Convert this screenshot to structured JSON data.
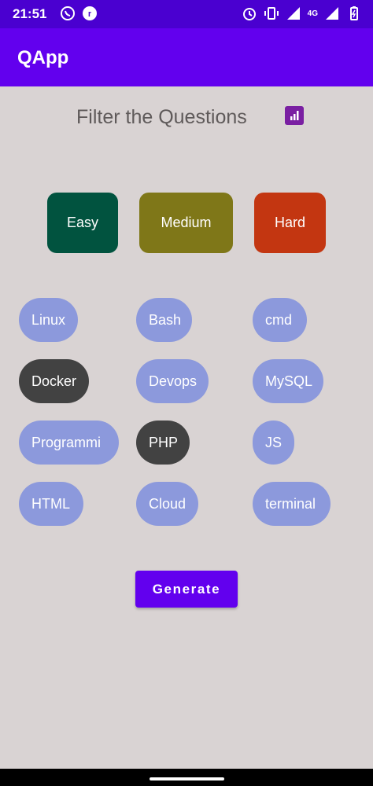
{
  "status_bar": {
    "time": "21:51",
    "network_label": "4G"
  },
  "app_bar": {
    "title": "QApp"
  },
  "filter": {
    "title": "Filter the Questions"
  },
  "difficulty": [
    {
      "label": "Easy",
      "color": "#01533f"
    },
    {
      "label": "Medium",
      "color": "#7f7718"
    },
    {
      "label": "Hard",
      "color": "#c33611"
    }
  ],
  "topics": [
    {
      "label": "Linux",
      "selected": false
    },
    {
      "label": "Bash",
      "selected": false
    },
    {
      "label": "cmd",
      "selected": false
    },
    {
      "label": "Docker",
      "selected": true
    },
    {
      "label": "Devops",
      "selected": false
    },
    {
      "label": "MySQL",
      "selected": false
    },
    {
      "label": "Programmi",
      "selected": false
    },
    {
      "label": "PHP",
      "selected": true
    },
    {
      "label": "JS",
      "selected": false
    },
    {
      "label": "HTML",
      "selected": false
    },
    {
      "label": "Cloud",
      "selected": false
    },
    {
      "label": "terminal",
      "selected": false
    }
  ],
  "generate": {
    "label": "Generate"
  },
  "colors": {
    "accent": "#6200ee",
    "status": "#4a00d0",
    "chip": "#8c99dc",
    "chip_selected": "#424242",
    "background": "#d9d3d3"
  }
}
